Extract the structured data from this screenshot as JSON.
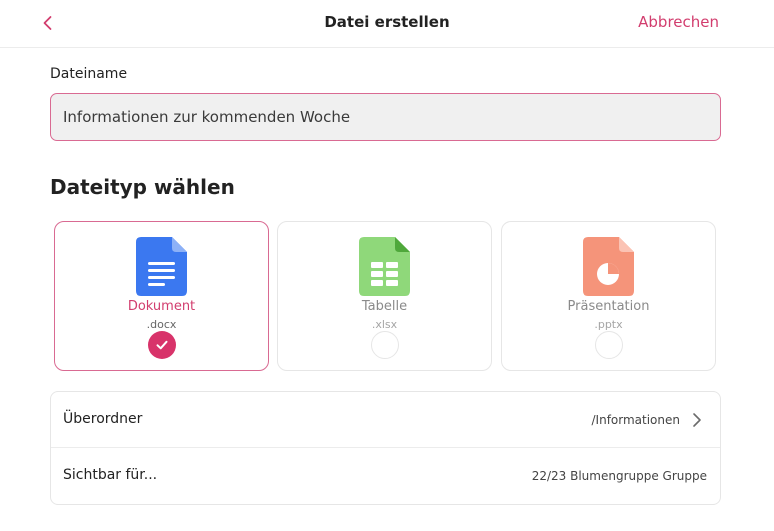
{
  "header": {
    "title": "Datei erstellen",
    "cancel_label": "Abbrechen",
    "back_icon": "chevron-left-icon",
    "accent_color": "#d23d6e"
  },
  "filename": {
    "label": "Dateiname",
    "value": "Informationen zur kommenden Woche"
  },
  "file_type": {
    "section_title": "Dateityp wählen",
    "options": [
      {
        "name": "Dokument",
        "extension": ".docx",
        "icon": "document-icon",
        "color": "#3b78f0",
        "selected": true
      },
      {
        "name": "Tabelle",
        "extension": ".xlsx",
        "icon": "spreadsheet-icon",
        "color": "#8fd87a",
        "selected": false
      },
      {
        "name": "Präsentation",
        "extension": ".pptx",
        "icon": "presentation-icon",
        "color": "#f5947a",
        "selected": false
      }
    ]
  },
  "settings": {
    "parent_folder": {
      "label": "Überordner",
      "value": "/Informationen"
    },
    "visible_for": {
      "label": "Sichtbar für...",
      "value": "22/23 Blumengruppe Gruppe"
    }
  }
}
